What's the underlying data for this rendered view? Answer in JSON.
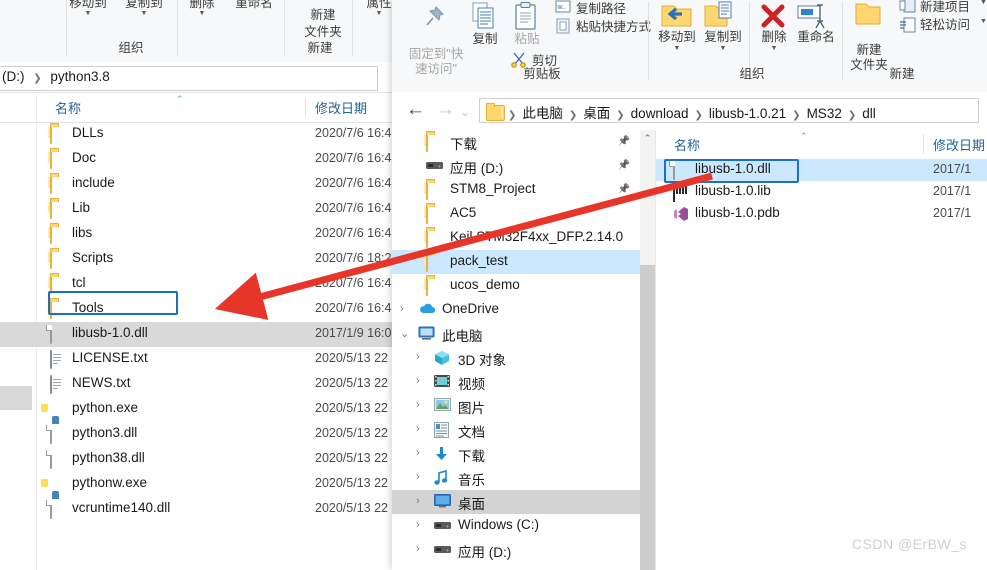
{
  "left_window": {
    "ribbon": {
      "buttons": [
        {
          "label": "移动到",
          "caret": true
        },
        {
          "label": "复制到",
          "caret": true
        },
        {
          "label": "删除",
          "caret": true
        },
        {
          "label": "重命名",
          "caret": false
        },
        {
          "label": "新建\n文件夹",
          "caret": false
        },
        {
          "label": "属性",
          "caret": true
        }
      ],
      "groups": [
        {
          "label": "组织"
        },
        {
          "label": "新建"
        }
      ]
    },
    "address_bar": {
      "segments": [
        "(D:)",
        "python3.8"
      ]
    },
    "columns": {
      "name": "名称",
      "date": "修改日期"
    },
    "rows": [
      {
        "name": "DLLs",
        "date": "2020/7/6 16:4",
        "icon": "folder-icon",
        "selected": false
      },
      {
        "name": "Doc",
        "date": "2020/7/6 16:4",
        "icon": "folder-icon",
        "selected": false
      },
      {
        "name": "include",
        "date": "2020/7/6 16:4",
        "icon": "folder-icon",
        "selected": false
      },
      {
        "name": "Lib",
        "date": "2020/7/6 16:4",
        "icon": "folder-icon",
        "selected": false
      },
      {
        "name": "libs",
        "date": "2020/7/6 16:4",
        "icon": "folder-icon",
        "selected": false
      },
      {
        "name": "Scripts",
        "date": "2020/7/6 18:2",
        "icon": "folder-icon",
        "selected": false
      },
      {
        "name": "tcl",
        "date": "2020/7/6 16:4",
        "icon": "folder-icon",
        "selected": false
      },
      {
        "name": "Tools",
        "date": "2020/7/6 16:4",
        "icon": "folder-icon",
        "selected": false
      },
      {
        "name": "libusb-1.0.dll",
        "date": "2017/1/9 16:0",
        "icon": "dll-file-icon",
        "selected": true
      },
      {
        "name": "LICENSE.txt",
        "date": "2020/5/13 22",
        "icon": "text-file-icon",
        "selected": false
      },
      {
        "name": "NEWS.txt",
        "date": "2020/5/13 22",
        "icon": "text-file-icon",
        "selected": false
      },
      {
        "name": "python.exe",
        "date": "2020/5/13 22",
        "icon": "python-exe-icon",
        "selected": false
      },
      {
        "name": "python3.dll",
        "date": "2020/5/13 22",
        "icon": "dll-file-icon",
        "selected": false
      },
      {
        "name": "python38.dll",
        "date": "2020/5/13 22",
        "icon": "dll-file-icon",
        "selected": false
      },
      {
        "name": "pythonw.exe",
        "date": "2020/5/13 22",
        "icon": "python-exe-icon",
        "selected": false
      },
      {
        "name": "vcruntime140.dll",
        "date": "2020/5/13 22",
        "icon": "dll-file-icon",
        "selected": false
      }
    ]
  },
  "right_window": {
    "ribbon": {
      "clipboard": {
        "group_label": "剪贴板",
        "pin": "固定到\"快\n速访问\"",
        "copy": "复制",
        "paste": "粘贴",
        "copy_path": "复制路径",
        "paste_shortcut": "粘贴快捷方式",
        "cut": "剪切"
      },
      "organize": {
        "group_label": "组织",
        "move_to": "移动到",
        "copy_to": "复制到",
        "delete": "删除",
        "rename": "重命名"
      },
      "new": {
        "group_label": "新建",
        "new_folder": "新建\n文件夹",
        "new_item": "新建项目",
        "easy_access": "轻松访问"
      }
    },
    "address_bar": {
      "back": "←",
      "forward": "→",
      "recent": "⌄",
      "up": "↑",
      "crumbs": [
        "此电脑",
        "桌面",
        "download",
        "libusb-1.0.21",
        "MS32",
        "dll"
      ]
    },
    "nav_tree": [
      {
        "label": "下载",
        "icon": "folder-icon",
        "indent": 34,
        "chevron": "",
        "pinned": true,
        "state": "normal"
      },
      {
        "label": "应用 (D:)",
        "icon": "drive-icon",
        "indent": 34,
        "chevron": "",
        "pinned": true,
        "state": "normal"
      },
      {
        "label": "STM8_Project",
        "icon": "folder-icon",
        "indent": 34,
        "chevron": "",
        "pinned": true,
        "state": "normal"
      },
      {
        "label": "AC5",
        "icon": "folder-icon",
        "indent": 34,
        "chevron": "",
        "pinned": false,
        "state": "normal"
      },
      {
        "label": "Keil.STM32F4xx_DFP.2.14.0",
        "icon": "folder-icon",
        "indent": 34,
        "chevron": "",
        "pinned": false,
        "state": "normal"
      },
      {
        "label": "pack_test",
        "icon": "folder-icon",
        "indent": 34,
        "chevron": "",
        "pinned": false,
        "state": "selected"
      },
      {
        "label": "ucos_demo",
        "icon": "folder-icon",
        "indent": 34,
        "chevron": "",
        "pinned": false,
        "state": "normal"
      },
      {
        "label": "OneDrive",
        "icon": "onedrive-icon",
        "indent": 26,
        "chevron": "›",
        "pinned": false,
        "state": "normal"
      },
      {
        "label": "此电脑",
        "icon": "this-pc-icon",
        "indent": 26,
        "chevron": "⌄",
        "pinned": false,
        "state": "normal"
      },
      {
        "label": "3D 对象",
        "icon": "3d-objects-icon",
        "indent": 42,
        "chevron": "›",
        "pinned": false,
        "state": "normal"
      },
      {
        "label": "视频",
        "icon": "videos-icon",
        "indent": 42,
        "chevron": "›",
        "pinned": false,
        "state": "normal"
      },
      {
        "label": "图片",
        "icon": "pictures-icon",
        "indent": 42,
        "chevron": "›",
        "pinned": false,
        "state": "normal"
      },
      {
        "label": "文档",
        "icon": "documents-icon",
        "indent": 42,
        "chevron": "›",
        "pinned": false,
        "state": "normal"
      },
      {
        "label": "下载",
        "icon": "downloads-icon",
        "indent": 42,
        "chevron": "›",
        "pinned": false,
        "state": "normal"
      },
      {
        "label": "音乐",
        "icon": "music-icon",
        "indent": 42,
        "chevron": "›",
        "pinned": false,
        "state": "normal"
      },
      {
        "label": "桌面",
        "icon": "desktop-icon",
        "indent": 42,
        "chevron": "›",
        "pinned": false,
        "state": "greyed"
      },
      {
        "label": "Windows (C:)",
        "icon": "drive-icon",
        "indent": 42,
        "chevron": "›",
        "pinned": false,
        "state": "normal"
      },
      {
        "label": "应用 (D:)",
        "icon": "drive-icon",
        "indent": 42,
        "chevron": "›",
        "pinned": false,
        "state": "normal"
      }
    ],
    "columns": {
      "name": "名称",
      "date": "修改日期"
    },
    "rows": [
      {
        "name": "libusb-1.0.dll",
        "date": "2017/1",
        "icon": "dll-file-icon",
        "selected": true
      },
      {
        "name": "libusb-1.0.lib",
        "date": "2017/1",
        "icon": "lib-file-icon",
        "selected": false
      },
      {
        "name": "libusb-1.0.pdb",
        "date": "2017/1",
        "icon": "pdb-file-icon",
        "selected": false
      }
    ]
  },
  "annotation": {
    "arrow_color": "#e8352a",
    "selection_outline_color": "#1d6fc4"
  },
  "watermark": "CSDN @ErBW_s"
}
